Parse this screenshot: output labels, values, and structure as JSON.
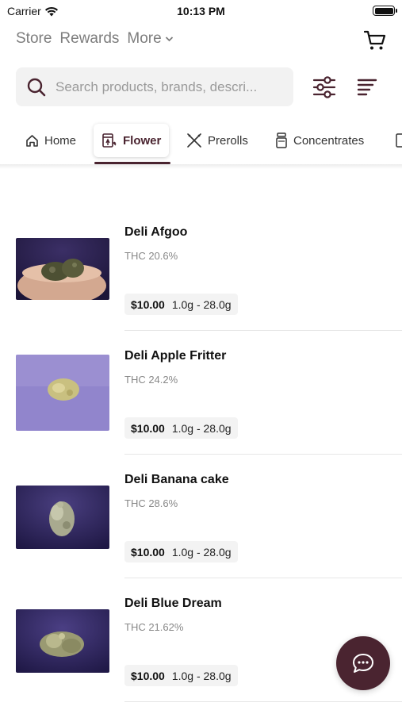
{
  "status": {
    "carrier": "Carrier",
    "time": "10:13 PM"
  },
  "nav": {
    "store": "Store",
    "rewards": "Rewards",
    "more": "More"
  },
  "search": {
    "placeholder": "Search products, brands, descri..."
  },
  "tabs": [
    {
      "label": "Home",
      "icon": "home-icon"
    },
    {
      "label": "Flower",
      "icon": "flower-icon",
      "active": true
    },
    {
      "label": "Prerolls",
      "icon": "preroll-icon"
    },
    {
      "label": "Concentrates",
      "icon": "concentrate-icon"
    }
  ],
  "products": [
    {
      "name": "Deli Afgoo",
      "thc": "THC 20.6%",
      "price": "$10.00",
      "weights": "1.0g - 28.0g"
    },
    {
      "name": "Deli Apple Fritter",
      "thc": "THC 24.2%",
      "price": "$10.00",
      "weights": "1.0g - 28.0g"
    },
    {
      "name": "Deli Banana cake",
      "thc": "THC 28.6%",
      "price": "$10.00",
      "weights": "1.0g - 28.0g"
    },
    {
      "name": "Deli Blue Dream",
      "thc": "THC 21.62%",
      "price": "$10.00",
      "weights": "1.0g - 28.0g"
    }
  ],
  "colors": {
    "brand": "#4a2430",
    "muted_text": "#7d7d7d"
  }
}
